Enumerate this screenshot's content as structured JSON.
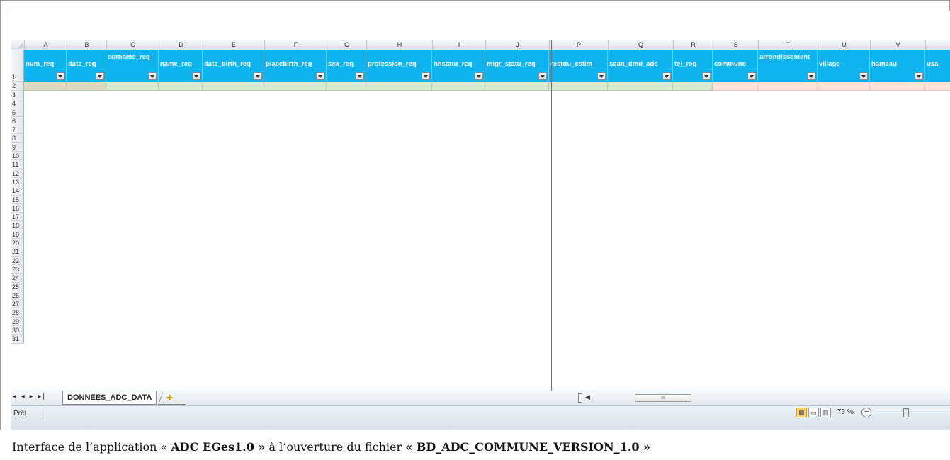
{
  "columns": [
    {
      "letter": "A",
      "header": "num_req",
      "wrap": false
    },
    {
      "letter": "B",
      "header": "date_req",
      "wrap": false
    },
    {
      "letter": "C",
      "header": "surname_req",
      "wrap": true
    },
    {
      "letter": "D",
      "header": "name_req",
      "wrap": false
    },
    {
      "letter": "E",
      "header": "date_birth_req",
      "wrap": false
    },
    {
      "letter": "F",
      "header": "placebirth_req",
      "wrap": false
    },
    {
      "letter": "G",
      "header": "sex_req",
      "wrap": false
    },
    {
      "letter": "H",
      "header": "profession_req",
      "wrap": false
    },
    {
      "letter": "I",
      "header": "hhstatu_req",
      "wrap": false
    },
    {
      "letter": "J",
      "header": "migr_statu_req",
      "wrap": false
    },
    {
      "letter": "P",
      "header": "restdu_estim",
      "wrap": false
    },
    {
      "letter": "Q",
      "header": "scan_dmd_adc",
      "wrap": false
    },
    {
      "letter": "R",
      "header": "tel_req",
      "wrap": false
    },
    {
      "letter": "S",
      "header": "commune",
      "wrap": false
    },
    {
      "letter": "T",
      "header": "arrondissement",
      "wrap": true
    },
    {
      "letter": "U",
      "header": "village",
      "wrap": false
    },
    {
      "letter": "V",
      "header": "hameau",
      "wrap": false
    },
    {
      "letter": "",
      "header": "usa",
      "wrap": false
    }
  ],
  "row_numbers": [
    "1",
    "2",
    "3",
    "4",
    "5",
    "6",
    "7",
    "8",
    "9",
    "10",
    "11",
    "12",
    "13",
    "14",
    "15",
    "16",
    "17",
    "18",
    "19",
    "20",
    "21",
    "22",
    "23",
    "24",
    "25",
    "26",
    "27",
    "28",
    "29",
    "30",
    "31"
  ],
  "sheet_tab": "DONNEES_ADC_DATA",
  "sheet_nav": "◂ ◂ ▸ ▸|",
  "status": {
    "text": "Prêt",
    "zoom": "73 %",
    "zoom_minus": "−"
  },
  "scroll_thumb": "III",
  "caption": {
    "prefix": "Interface de l’application « ",
    "app": "ADC EGes1.0 »",
    "mid": " à l’ouverture du fichier ",
    "file": "« BD_ADC_COMMUNE_VERSION_1.0 »"
  },
  "colors": {
    "header_bg": "#0fb4ee",
    "row2_green": "#d9ead3",
    "row2_tan": "#ddd9c3",
    "row2_pink": "#fde3d9"
  }
}
